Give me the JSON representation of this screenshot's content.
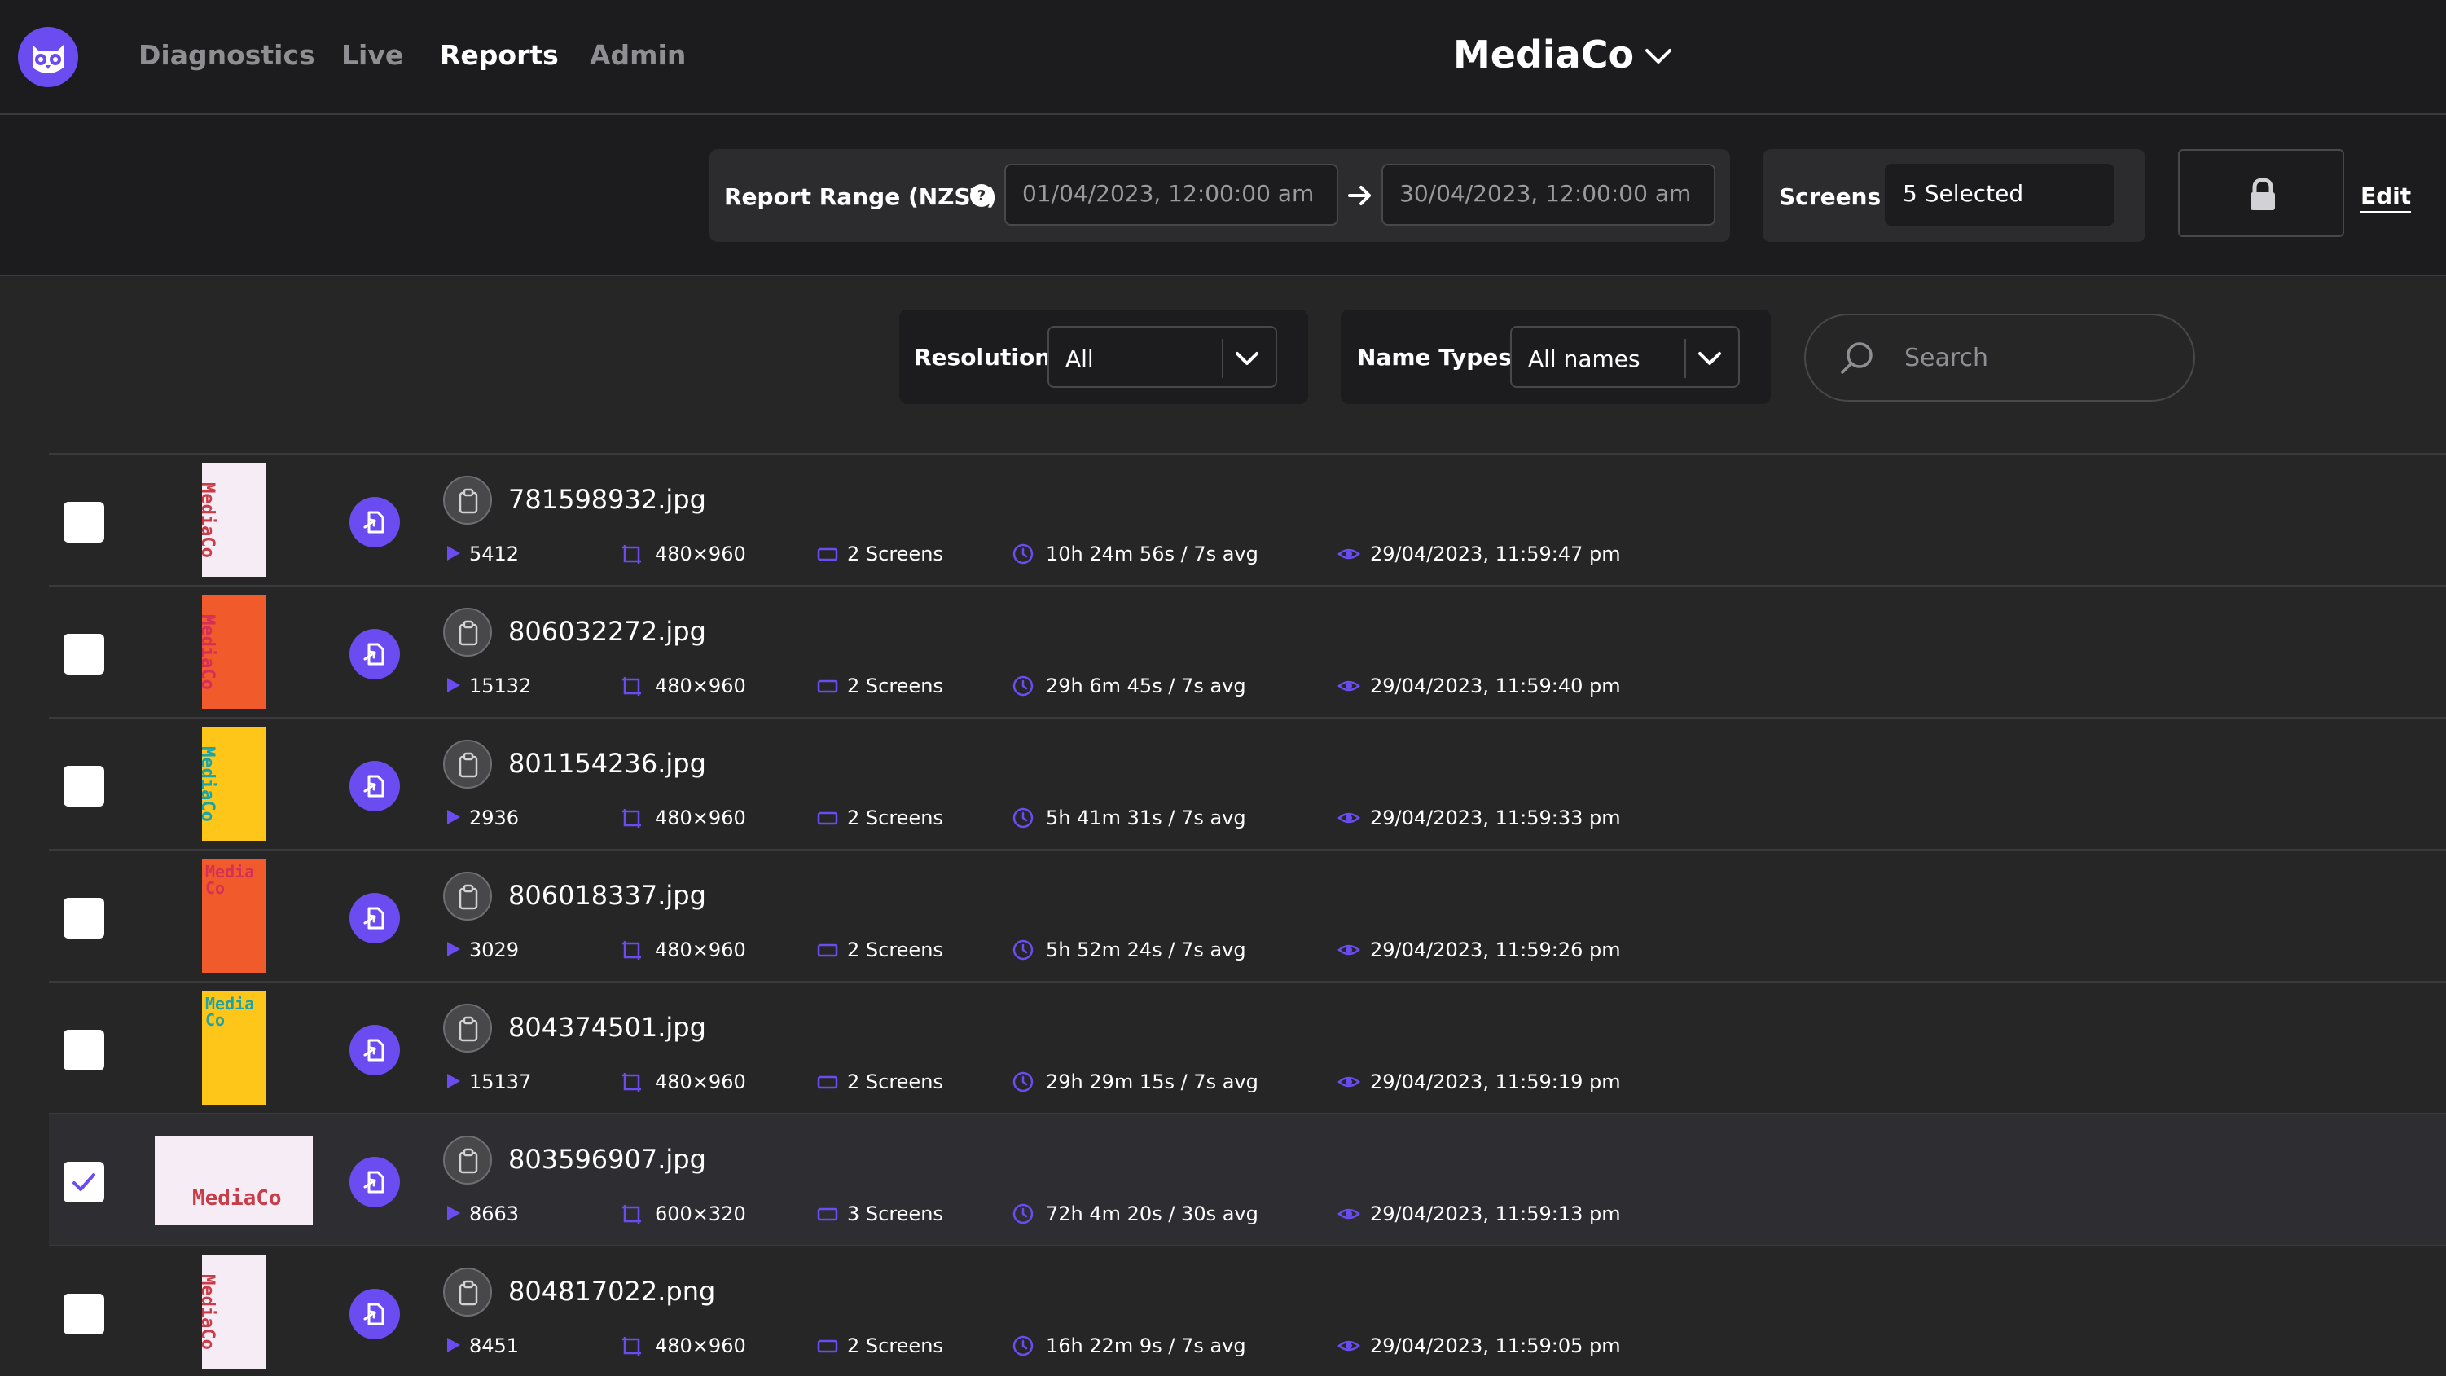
{
  "nav": {
    "links": [
      "Diagnostics",
      "Live",
      "Reports",
      "Admin"
    ],
    "active": "Reports",
    "org": "MediaCo"
  },
  "toolbar": {
    "range_label": "Report Range (NZST)",
    "range_start": "01/04/2023, 12:00:00 am",
    "range_end": "30/04/2023, 12:00:00 am",
    "screens_label": "Screens",
    "screens_value": "5 Selected",
    "edit_label": "Edit"
  },
  "filters": {
    "resolution_label": "Resolution",
    "resolution_value": "All",
    "name_types_label": "Name Types",
    "name_types_value": "All names",
    "search_placeholder": "Search"
  },
  "colors": {
    "accent": "#6b4cf0",
    "thumb_pink": "#f6ecf6",
    "thumb_orange": "#f15a2a",
    "thumb_yellow": "#ffc61a"
  },
  "rows": [
    {
      "name": "781598932.jpg",
      "plays": "5412",
      "resolution": "480×960",
      "screens": "2 Screens",
      "duration": "10h 24m 56s / 7s avg",
      "last_seen": "29/04/2023, 11:59:47 pm",
      "checked": false,
      "thumb": "pink",
      "thumb_text": "MediaCo"
    },
    {
      "name": "806032272.jpg",
      "plays": "15132",
      "resolution": "480×960",
      "screens": "2 Screens",
      "duration": "29h 6m 45s / 7s avg",
      "last_seen": "29/04/2023, 11:59:40 pm",
      "checked": false,
      "thumb": "orange",
      "thumb_text": "MediaCo"
    },
    {
      "name": "801154236.jpg",
      "plays": "2936",
      "resolution": "480×960",
      "screens": "2 Screens",
      "duration": "5h 41m 31s / 7s avg",
      "last_seen": "29/04/2023, 11:59:33 pm",
      "checked": false,
      "thumb": "yellow",
      "thumb_text": "MediaCo"
    },
    {
      "name": "806018337.jpg",
      "plays": "3029",
      "resolution": "480×960",
      "screens": "2 Screens",
      "duration": "5h 52m 24s / 7s avg",
      "last_seen": "29/04/2023, 11:59:26 pm",
      "checked": false,
      "thumb": "orange",
      "thumb_text": "Media Co"
    },
    {
      "name": "804374501.jpg",
      "plays": "15137",
      "resolution": "480×960",
      "screens": "2 Screens",
      "duration": "29h 29m 15s / 7s avg",
      "last_seen": "29/04/2023, 11:59:19 pm",
      "checked": false,
      "thumb": "yellow",
      "thumb_text": "Media Co"
    },
    {
      "name": "803596907.jpg",
      "plays": "8663",
      "resolution": "600×320",
      "screens": "3 Screens",
      "duration": "72h 4m 20s / 30s avg",
      "last_seen": "29/04/2023, 11:59:13 pm",
      "checked": true,
      "thumb": "pink-wide",
      "thumb_text": "MediaCo"
    },
    {
      "name": "804817022.png",
      "plays": "8451",
      "resolution": "480×960",
      "screens": "2 Screens",
      "duration": "16h 22m 9s / 7s avg",
      "last_seen": "29/04/2023, 11:59:05 pm",
      "checked": false,
      "thumb": "pink",
      "thumb_text": "MediaCo"
    }
  ]
}
